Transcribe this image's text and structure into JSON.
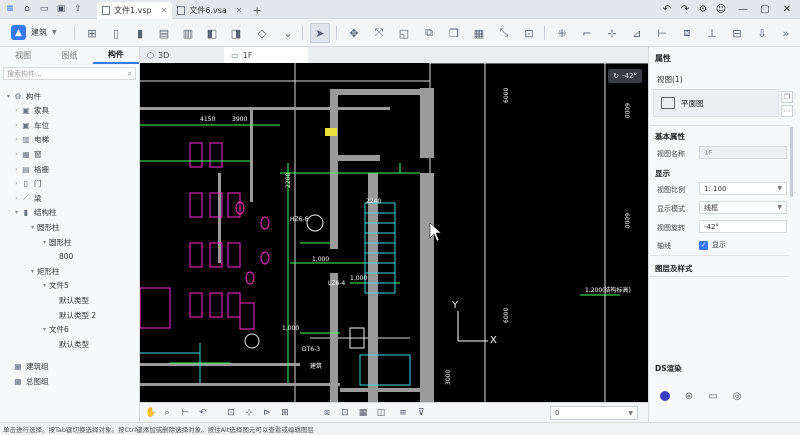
{
  "titlebar": {
    "tabs": [
      {
        "label": "文件1.vsp",
        "active": true
      },
      {
        "label": "文件6.vsa",
        "active": false
      }
    ],
    "new_tab": "+"
  },
  "toolbar": {
    "mode": "建筑"
  },
  "left_panel": {
    "tabs": [
      "视图",
      "图纸",
      "构件"
    ],
    "active_tab": "构件",
    "search_placeholder": "搜索构件...",
    "tree": [
      {
        "label": "构件",
        "depth": 0,
        "expander": "expanded",
        "icon": "gear-icon",
        "glyph": "⚙"
      },
      {
        "label": "家具",
        "depth": 1,
        "expander": "collapsed",
        "icon": "sofa-icon",
        "glyph": "▣"
      },
      {
        "label": "车位",
        "depth": 1,
        "expander": "collapsed",
        "icon": "car-icon",
        "glyph": "▣"
      },
      {
        "label": "电梯",
        "depth": 1,
        "expander": "collapsed",
        "icon": "elevator-icon",
        "glyph": "▥"
      },
      {
        "label": "窗",
        "depth": 1,
        "expander": "collapsed",
        "icon": "window-icon",
        "glyph": "▦"
      },
      {
        "label": "格栅",
        "depth": 1,
        "expander": "collapsed",
        "icon": "grille-icon",
        "glyph": "▤"
      },
      {
        "label": "门",
        "depth": 1,
        "expander": "collapsed",
        "icon": "door-icon",
        "glyph": "▯"
      },
      {
        "label": "梁",
        "depth": 1,
        "expander": "collapsed",
        "icon": "beam-icon",
        "glyph": "⟋"
      },
      {
        "label": "结构柱",
        "depth": 1,
        "expander": "expanded",
        "icon": "column-icon",
        "glyph": "▮"
      },
      {
        "label": "圆形柱",
        "depth": 2,
        "expander": "expanded",
        "icon": "",
        "glyph": ""
      },
      {
        "label": "圆形柱",
        "depth": 3,
        "expander": "expanded",
        "icon": "",
        "glyph": ""
      },
      {
        "label": "800",
        "depth": 4,
        "expander": "none",
        "icon": "",
        "glyph": ""
      },
      {
        "label": "矩形柱",
        "depth": 2,
        "expander": "expanded",
        "icon": "",
        "glyph": ""
      },
      {
        "label": "文件5",
        "depth": 3,
        "expander": "expanded",
        "icon": "",
        "glyph": ""
      },
      {
        "label": "默认类型",
        "depth": 4,
        "expander": "none",
        "icon": "",
        "glyph": ""
      },
      {
        "label": "默认类型 2",
        "depth": 4,
        "expander": "none",
        "icon": "",
        "glyph": ""
      },
      {
        "label": "文件6",
        "depth": 3,
        "expander": "expanded",
        "icon": "",
        "glyph": ""
      },
      {
        "label": "默认类型",
        "depth": 4,
        "expander": "none",
        "icon": "",
        "glyph": ""
      },
      {
        "label": "建筑组",
        "depth": 0,
        "expander": "none",
        "icon": "group-icon",
        "glyph": "▦"
      },
      {
        "label": "总图组",
        "depth": 0,
        "expander": "none",
        "icon": "site-group-icon",
        "glyph": "▦"
      }
    ]
  },
  "view_tabs": [
    {
      "label": "3D",
      "active": false
    },
    {
      "label": "1F",
      "active": true
    }
  ],
  "canvas": {
    "rotation_badge": "-42°",
    "axis_x": "X",
    "axis_y": "Y",
    "dims": [
      "4150",
      "6000",
      "6000",
      "3900",
      "6000",
      "6000",
      "3000",
      "2200",
      "2240",
      "1,000",
      "1,000",
      "1,000",
      "1,200(结构标高)",
      "DT6-3",
      "建筑",
      "LZ6-4",
      "HZ6-6"
    ]
  },
  "bottom_toolbar": {
    "floor_value": "0"
  },
  "right_panel": {
    "title": "属性",
    "view_count": "视图(1)",
    "view_type": "平面图",
    "basic_section": "基本属性",
    "view_name_label": "视图名称",
    "view_name_value": "1F",
    "display_section": "显示",
    "scale_label": "视图比例",
    "scale_value": "1: 100",
    "display_mode_label": "显示模式",
    "display_mode_value": "线框",
    "rotation_label": "视图旋转",
    "rotation_value": "-42°",
    "axis_label": "轴线",
    "axis_check_label": "显示",
    "layer_section": "图层及样式",
    "ds_section": "DS渲染"
  },
  "status": {
    "text": "单击进行选择。按Tab键切换选择对象。按Ctrl键添加或删除选择对象。按住Alt选择图元可以查看或编辑图层"
  },
  "colors": {
    "accent": "#3579f6",
    "canvas_bg": "#000000",
    "wall": "#a6a6a6",
    "magenta": "#ff2bd6",
    "green": "#39ff59",
    "cyan": "#3bd7e8"
  }
}
